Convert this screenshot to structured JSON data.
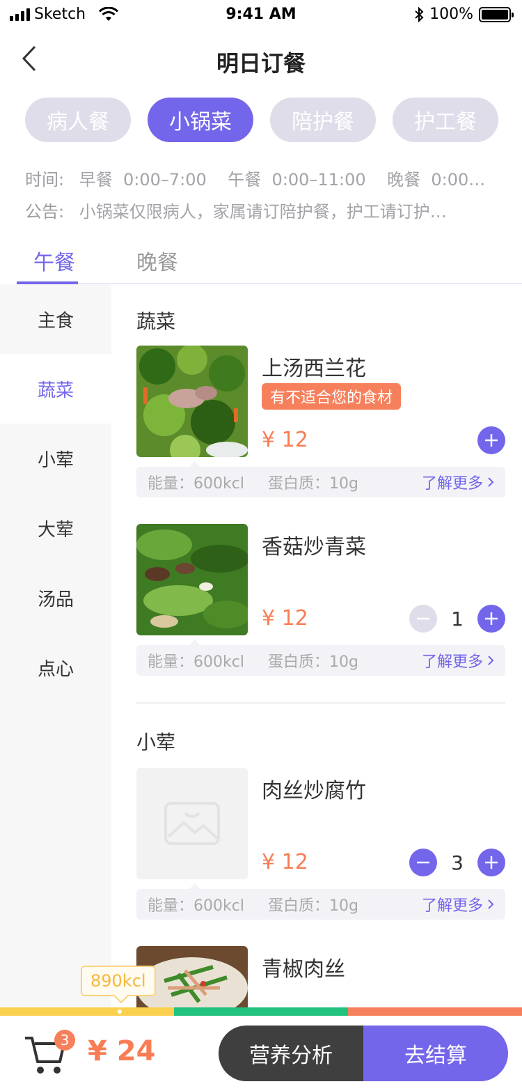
{
  "status_bar": {
    "carrier": "Sketch",
    "time": "9:41 AM",
    "battery": "100%"
  },
  "header": {
    "title": "明日订餐"
  },
  "meal_types": [
    {
      "label": "病人餐"
    },
    {
      "label": "小锅菜"
    },
    {
      "label": "陪护餐"
    },
    {
      "label": "护工餐"
    }
  ],
  "info": {
    "time_label": "时间:",
    "time_text": "早餐  0:00–7:00    午餐  0:00–11:00    晚餐  0:00…",
    "notice_label": "公告:",
    "notice_text": "小锅菜仅限病人，家属请订陪护餐，护工请订护…"
  },
  "tabs": [
    {
      "label": "午餐"
    },
    {
      "label": "晚餐"
    }
  ],
  "sidebar": {
    "items": [
      {
        "label": "主食"
      },
      {
        "label": "蔬菜"
      },
      {
        "label": "小荤"
      },
      {
        "label": "大荤"
      },
      {
        "label": "汤品"
      },
      {
        "label": "点心"
      }
    ]
  },
  "sections": [
    {
      "title": "蔬菜",
      "dishes": [
        {
          "name": "上汤西兰花",
          "warning": "有不适合您的食材",
          "price": "¥ 12",
          "energy": "能量：600kcl",
          "protein": "蛋白质：10g",
          "more": "了解更多"
        },
        {
          "name": "香菇炒青菜",
          "price": "¥ 12",
          "quantity": "1",
          "energy": "能量：600kcl",
          "protein": "蛋白质：10g",
          "more": "了解更多"
        }
      ]
    },
    {
      "title": "小荤",
      "dishes": [
        {
          "name": "肉丝炒腐竹",
          "price": "¥ 12",
          "quantity": "3",
          "energy": "能量：600kcl",
          "protein": "蛋白质：10g",
          "more": "了解更多"
        },
        {
          "name": "青椒肉丝"
        }
      ]
    }
  ],
  "nutrition_bar": {
    "kcal": "890kcl",
    "colors": [
      "#fbd04f",
      "#20c27c",
      "#f7805c"
    ]
  },
  "cart": {
    "count": "3",
    "total": "¥ 24"
  },
  "actions": {
    "analysis": "营养分析",
    "checkout": "去结算"
  },
  "colors": {
    "accent": "#7366ea",
    "price": "#f87d55",
    "warning": "#f7805c"
  }
}
